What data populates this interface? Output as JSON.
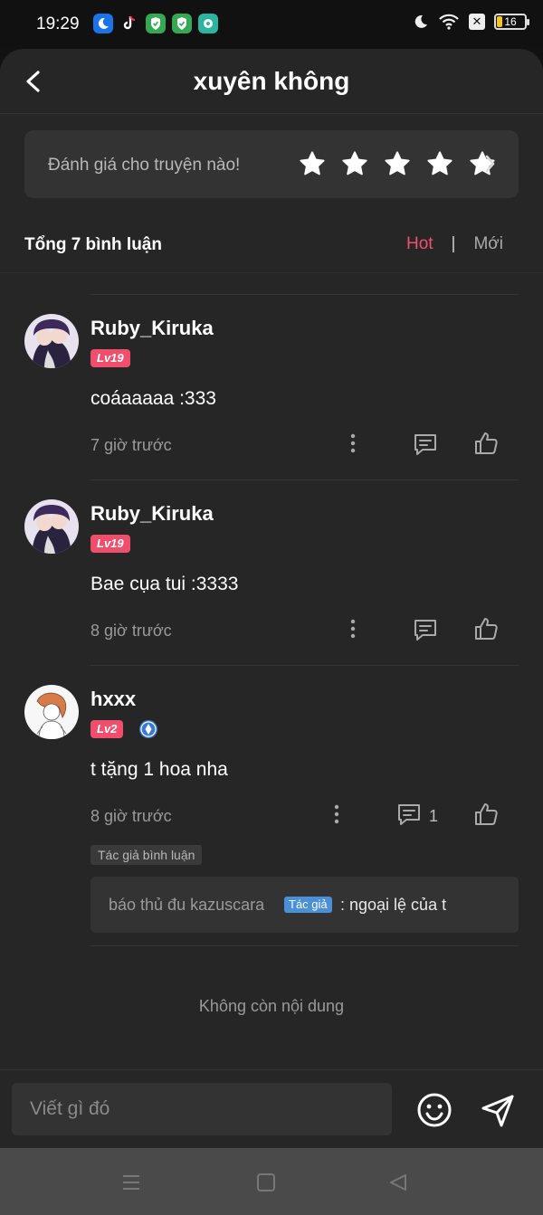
{
  "status_bar": {
    "time": "19:29",
    "battery": "16",
    "apps": [
      {
        "icon": "moon-app-icon",
        "color": "#1a73e8"
      },
      {
        "icon": "tiktok-icon",
        "color": "#111111"
      },
      {
        "icon": "shield-app-icon",
        "color": "#34a853"
      },
      {
        "icon": "shield-app-icon",
        "color": "#34a853"
      },
      {
        "icon": "chat-app-icon",
        "color": "#2bb5a0"
      }
    ]
  },
  "header": {
    "title": "xuyên không"
  },
  "rating": {
    "label": "Đánh giá cho truyện nào!",
    "stars": 5
  },
  "comments_header": {
    "total": "Tổng 7 bình luận",
    "sort_hot": "Hot",
    "sort_separator": "|",
    "sort_new": "Mới"
  },
  "comments": [
    {
      "user": "Ruby_Kiruka",
      "level": "Lv19",
      "text": "coáaaaaa :333",
      "time": "7 giờ trước"
    },
    {
      "user": "Ruby_Kiruka",
      "level": "Lv19",
      "text": "Bae cụa tui :3333",
      "time": "8 giờ trước"
    },
    {
      "user": "hxxx",
      "level": "Lv2",
      "text": "t tặng 1 hoa nha",
      "time": "8 giờ trước",
      "reply_count": "1"
    }
  ],
  "reply": {
    "author_tag": "Tác giả bình luận",
    "user": "báo thủ đu kazuscara",
    "badge": "Tác giả",
    "text": ": ngoại lệ của t"
  },
  "footer": {
    "no_more": "Không còn nội dung"
  },
  "input": {
    "placeholder": "Viết gì đó"
  },
  "colors": {
    "accent": "#f0506e",
    "level_badge": "#ef4f6d",
    "author_badge": "#4a90d9",
    "background": "#262626"
  }
}
